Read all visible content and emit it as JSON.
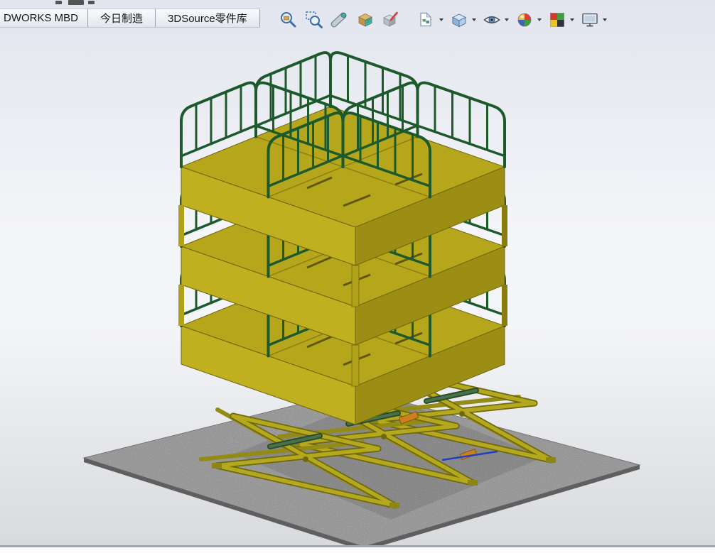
{
  "header": {
    "tabs": [
      {
        "label": "DWORKS MBD"
      },
      {
        "label": "今日制造"
      },
      {
        "label": "3DSource零件库"
      }
    ],
    "toolbar_icons": [
      {
        "name": "zoom-to-fit",
        "has_dropdown": false
      },
      {
        "name": "zoom-to-area",
        "has_dropdown": false
      },
      {
        "name": "previous-view",
        "has_dropdown": false
      },
      {
        "name": "section-view",
        "has_dropdown": false
      },
      {
        "name": "annotation-views",
        "has_dropdown": false
      },
      {
        "name": "apply-scene",
        "has_dropdown": true
      },
      {
        "name": "view-orientation",
        "has_dropdown": true
      },
      {
        "name": "hide-show-items",
        "has_dropdown": true
      },
      {
        "name": "edit-appearance",
        "has_dropdown": true
      },
      {
        "name": "render-options",
        "has_dropdown": true
      },
      {
        "name": "view-settings",
        "has_dropdown": true
      }
    ]
  },
  "viewport": {
    "colors": {
      "deck-top": "#b6a61c",
      "deck-left": "#c0b020",
      "deck-right": "#9c8e14",
      "rail-green": "#1c5a2c",
      "scissor-yellow": "#b4a81f",
      "scissor-dark": "#756b0b",
      "ground-gray": "#8e8e8e",
      "ground-edge": "#5f5f5f",
      "hydraulic-green": "#2b4a2b",
      "detail-orange": "#cd7f1e",
      "detail-blue": "#2040c0",
      "bg-top": "#e2e5ee",
      "bg-mid": "#f4f5f8",
      "bg-bottom": "#d8dade"
    }
  }
}
